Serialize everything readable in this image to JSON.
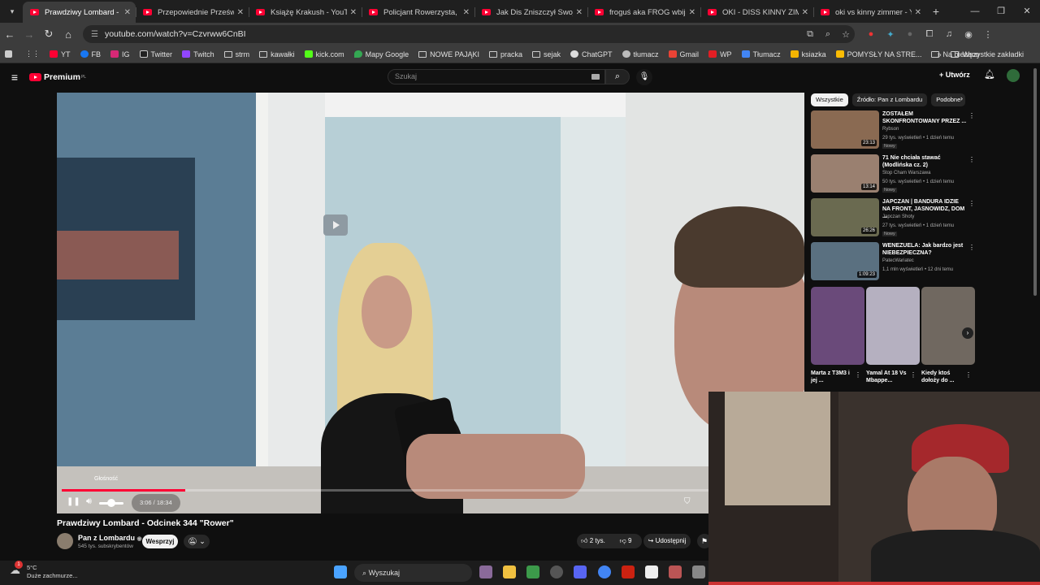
{
  "browser": {
    "tabs": [
      {
        "label": "Prawdziwy Lombard - O",
        "active": true
      },
      {
        "label": "Przepowiednie Prześwira"
      },
      {
        "label": "Książę Krakush - YouTube"
      },
      {
        "label": "Policjant Rowerzysta, któr"
      },
      {
        "label": "Jak Dis Zniszczył Swoją Ka"
      },
      {
        "label": "froguś aka FROG wbija się"
      },
      {
        "label": "OKI - DISS KINNY ZIMME"
      },
      {
        "label": "oki vs kinny zimmer - You"
      }
    ],
    "url": "youtube.com/watch?v=Czvrww6CnBI",
    "bookmarks": [
      "YT",
      "FB",
      "IG",
      "Twitter",
      "Twitch",
      "strm",
      "kawałki",
      "kick.com",
      "Mapy Google",
      "NOWE PAJĄKI",
      "pracka",
      "sejak",
      "ChatGPT",
      "tłumacz",
      "Gmail",
      "WP",
      "Tłumacz",
      "ksiazka",
      "POMYSŁY NA STRE...",
      "Na bieżąco"
    ],
    "all_bookmarks": "Wszystkie zakładki"
  },
  "youtube": {
    "logo": "Premium",
    "logo_region": "PL",
    "search_placeholder": "Szukaj",
    "create_label": "Utwórz",
    "video": {
      "tooltip": "Głośność",
      "time": "3:06 / 18:34",
      "progress": 0.1669,
      "title": "Prawdziwy Lombard - Odcinek 344 \"Rower\"",
      "channel": "Pan z Lombardu",
      "subscribers": "545 tys. subskrybentów",
      "support_label": "Wesprzyj",
      "likes": "2 tys.",
      "dislikes": "9",
      "share_label": "Udostępnij"
    },
    "chips": [
      "Wszystkie",
      "Źródło: Pan z Lombardu",
      "Podobne"
    ],
    "recommendations": [
      {
        "title": "ZOSTAŁEM SKONFRONTOWANY PRZEZ ...",
        "channel": "Rybson",
        "meta": "29 tys. wyświetleń • 1 dzień temu",
        "badge": "Nowy",
        "duration": "23:13",
        "color": "#8a6a52"
      },
      {
        "title": "71 Nie chciała stawać (Modlińska cz. 2)",
        "channel": "Stop Cham Warszawa",
        "meta": "50 tys. wyświetleń • 1 dzień temu",
        "badge": "Nowy",
        "duration": "13:14",
        "color": "#9a8070"
      },
      {
        "title": "JAPCZAN | BANDURA IDZIE NA FRONT, JASNOWIDZ, DOM ...",
        "channel": "Japczan Shoty",
        "meta": "27 tys. wyświetleń • 1 dzień temu",
        "badge": "Nowy",
        "duration": "26:26",
        "color": "#6a6a50"
      },
      {
        "title": "WENEZUELA: Jak bardzo jest NIEBEZPIECZNA?",
        "channel": "PatecWariatec",
        "meta": "1,1 mln wyświetleń • 12 dni temu",
        "badge": "",
        "duration": "1:09:23",
        "color": "#5a7080"
      }
    ],
    "shorts": [
      {
        "label": "Marta z T3M3 i jej ...",
        "color": "#6a4a7a"
      },
      {
        "label": "Yamal At 18 Vs Mbappe...",
        "color": "#b5b0c0"
      },
      {
        "label": "Kiedy ktoś dołoży do ...",
        "color": "#706860"
      }
    ]
  },
  "taskbar": {
    "temp": "5°C",
    "weather": "Duże zachmurze...",
    "notif_count": "1",
    "search_label": "Wyszukaj"
  }
}
